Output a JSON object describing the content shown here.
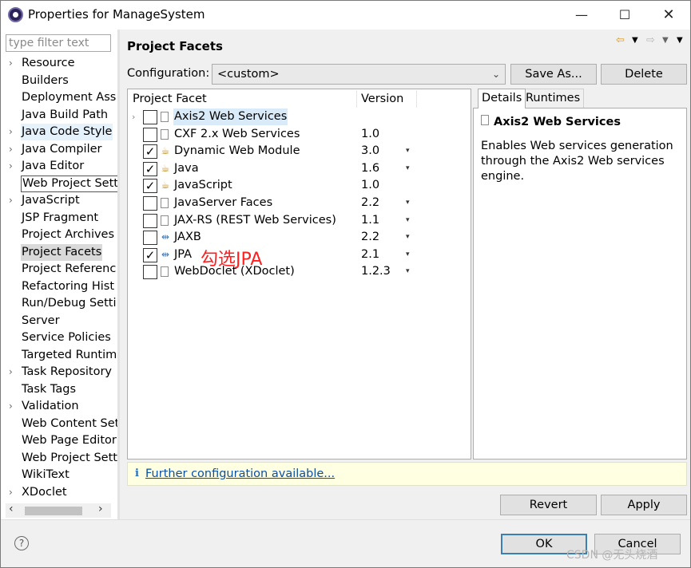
{
  "window": {
    "title": "Properties for ManageSystem",
    "minimize": "—",
    "maximize": "☐",
    "close": "✕"
  },
  "filter": {
    "placeholder": "type filter text",
    "value": ""
  },
  "nav": {
    "items": [
      {
        "label": "Resource",
        "expandable": true
      },
      {
        "label": "Builders",
        "expandable": false
      },
      {
        "label": "Deployment Ass",
        "expandable": false
      },
      {
        "label": "Java Build Path",
        "expandable": false
      },
      {
        "label": "Java Code Style",
        "expandable": true
      },
      {
        "label": "Java Compiler",
        "expandable": true
      },
      {
        "label": "Java Editor",
        "expandable": true
      },
      {
        "label": "Web Project Setti",
        "expandable": false
      },
      {
        "label": "JavaScript",
        "expandable": true
      },
      {
        "label": "JSP Fragment",
        "expandable": false
      },
      {
        "label": "Project Archives",
        "expandable": false
      },
      {
        "label": "Project Facets",
        "expandable": false
      },
      {
        "label": "Project Referenc",
        "expandable": false
      },
      {
        "label": "Refactoring Hist",
        "expandable": false
      },
      {
        "label": "Run/Debug Setti",
        "expandable": false
      },
      {
        "label": "Server",
        "expandable": false
      },
      {
        "label": "Service Policies",
        "expandable": false
      },
      {
        "label": "Targeted Runtim",
        "expandable": false
      },
      {
        "label": "Task Repository",
        "expandable": true
      },
      {
        "label": "Task Tags",
        "expandable": false
      },
      {
        "label": "Validation",
        "expandable": true
      },
      {
        "label": "Web Content Set",
        "expandable": false
      },
      {
        "label": "Web Page Editor",
        "expandable": false
      },
      {
        "label": "Web Project Sett",
        "expandable": false
      },
      {
        "label": "WikiText",
        "expandable": false
      },
      {
        "label": "XDoclet",
        "expandable": true
      }
    ],
    "selected": "Project Facets"
  },
  "page": {
    "title": "Project Facets"
  },
  "config": {
    "label": "Configuration:",
    "value": "<custom>",
    "save_as": "Save As...",
    "delete": "Delete"
  },
  "table": {
    "headers": {
      "facet": "Project Facet",
      "version": "Version"
    },
    "rows": [
      {
        "name": "Axis2 Web Services",
        "version": "",
        "checked": false,
        "icon": "page-icon",
        "has_dropdown": false,
        "expandable": true,
        "selected": true
      },
      {
        "name": "CXF 2.x Web Services",
        "version": "1.0",
        "checked": false,
        "icon": "page-icon",
        "has_dropdown": false
      },
      {
        "name": "Dynamic Web Module",
        "version": "3.0",
        "checked": true,
        "icon": "web-module-icon",
        "has_dropdown": true
      },
      {
        "name": "Java",
        "version": "1.6",
        "checked": true,
        "icon": "java-icon",
        "has_dropdown": true
      },
      {
        "name": "JavaScript",
        "version": "1.0",
        "checked": true,
        "icon": "javascript-icon",
        "has_dropdown": false
      },
      {
        "name": "JavaServer Faces",
        "version": "2.2",
        "checked": false,
        "icon": "page-icon",
        "has_dropdown": true
      },
      {
        "name": "JAX-RS (REST Web Services)",
        "version": "1.1",
        "checked": false,
        "icon": "page-icon",
        "has_dropdown": true
      },
      {
        "name": "JAXB",
        "version": "2.2",
        "checked": false,
        "icon": "plug-icon",
        "has_dropdown": true
      },
      {
        "name": "JPA",
        "version": "2.1",
        "checked": true,
        "icon": "plug-icon",
        "has_dropdown": true
      },
      {
        "name": "WebDoclet (XDoclet)",
        "version": "1.2.3",
        "checked": false,
        "icon": "page-icon",
        "has_dropdown": true
      }
    ],
    "check_glyph": "✓",
    "dropdown_glyph": "▾"
  },
  "annotation": {
    "text": "勾选JPA",
    "color": "#ff1f1f"
  },
  "details": {
    "tabs": [
      "Details",
      "Runtimes"
    ],
    "active_tab": "Details",
    "title": "Axis2 Web Services",
    "description": "Enables Web services generation through the Axis2 Web services engine."
  },
  "info": {
    "icon": "i",
    "link": "Further configuration available..."
  },
  "buttons": {
    "revert": "Revert",
    "apply": "Apply",
    "ok": "OK",
    "cancel": "Cancel",
    "help": "?"
  },
  "watermark": "CSDN @无头烧酒",
  "colors": {
    "selection": "#d9ebf9",
    "info_bg": "#ffffe1",
    "link": "#0b4fa3",
    "annotation": "#ff1f1f"
  }
}
